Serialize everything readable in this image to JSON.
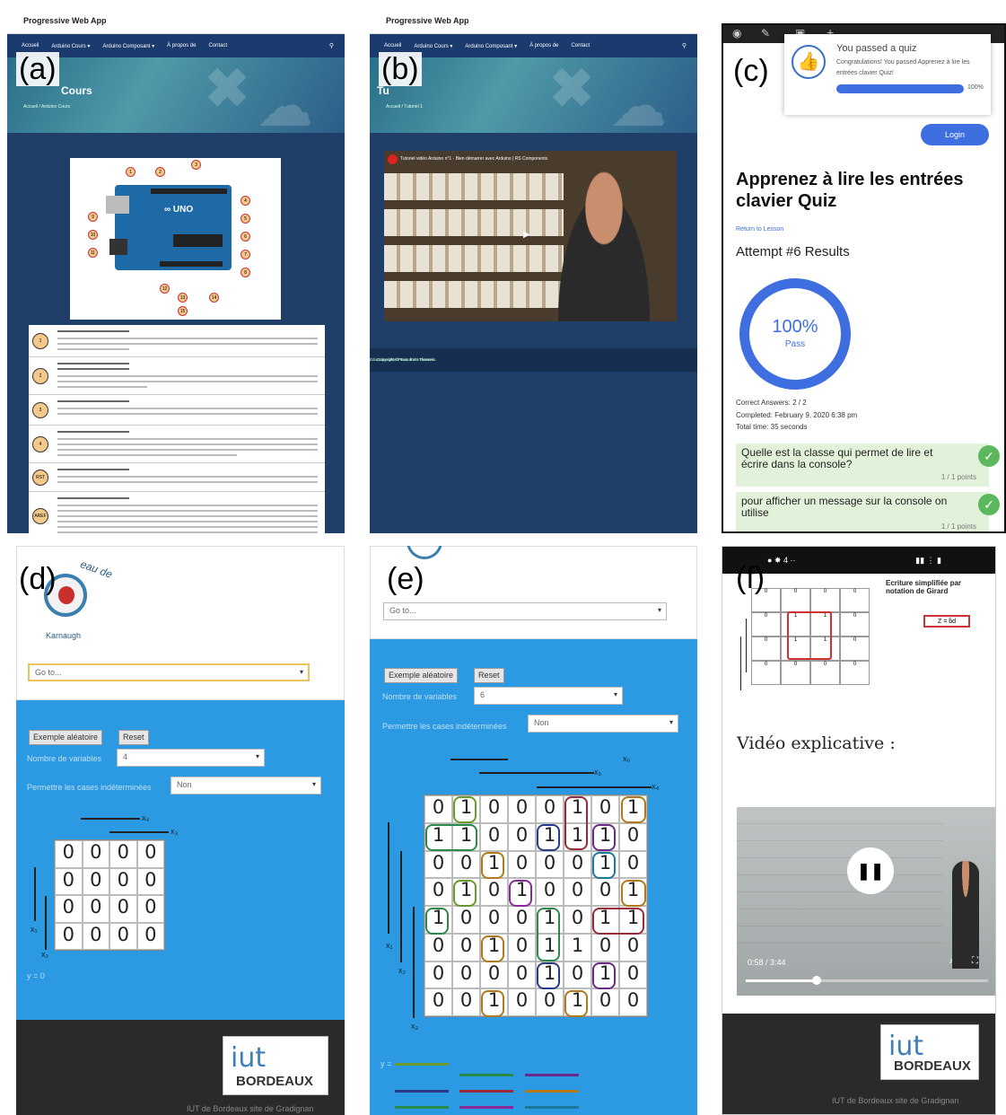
{
  "labels": {
    "a": "(a)",
    "b": "(b)",
    "c": "(c)",
    "d": "(d)",
    "e": "(e)",
    "f": "(f)"
  },
  "pwa": {
    "app_title": "Progressive Web App",
    "nav": [
      "Accueil",
      "Arduino Cours ▾",
      "Arduino Composant ▾",
      "À propos de",
      "Contact"
    ],
    "search_icon": "search-icon"
  },
  "panel_a": {
    "hero_title": "Cours",
    "crumb": "Accueil  /  Arduino Cours",
    "rows": [
      "1",
      "2",
      "3",
      "4",
      "RST",
      "AREF"
    ]
  },
  "panel_b": {
    "hero_title": "Tu",
    "crumb": "Accueil  /  Tutoriel 1",
    "video_title": "Tutoriel vidéo Arduino n°1 - Bien démarrer avec Arduino | RS Components",
    "footer_left": "Copyright © Tous droits réservés.",
    "footer_right": "Éducation WordPress Kele Themes"
  },
  "panel_c": {
    "toast_title": "You passed a quiz",
    "toast_text": "Congratulations! You passed Apprenez à lire les entrées clavier Quiz!",
    "progress": 100,
    "progress_label": "100%",
    "login": "Login",
    "heading": "Apprenez à lire les entrées clavier Quiz",
    "return_link": "Return to Lesson",
    "attempt": "Attempt #6 Results",
    "score": "100%",
    "pass": "Pass",
    "correct": "Correct Answers: 2 / 2",
    "completed": "Completed: February 9, 2020 6:38 pm",
    "total_time": "Total time: 35 seconds",
    "questions": [
      {
        "text": "Quelle est la classe qui permet de lire et écrire dans la console?",
        "points": "1 / 1 points"
      },
      {
        "text": "pour afficher un message sur la console on utilise",
        "points": "1 / 1 points"
      }
    ]
  },
  "panel_d": {
    "logo_text": "Karnaugh",
    "logo_arc": "eau de",
    "goto": "Go to...",
    "random": "Exemple aléatoire",
    "reset": "Reset",
    "nvars_label": "Nombre de variables",
    "nvars": "4",
    "indet_label": "Permettre les cases indéterminées",
    "indet": "Non",
    "cells": [
      "0",
      "0",
      "0",
      "0",
      "0",
      "0",
      "0",
      "0",
      "0",
      "0",
      "0",
      "0",
      "0",
      "0",
      "0",
      "0"
    ],
    "x1": "x₁",
    "x2": "x₂",
    "x3": "x₃",
    "x4": "x₄",
    "result": "y = 0",
    "footer": "IUT de Bordeaux site de Gradignan"
  },
  "panel_e": {
    "goto": "Go to...",
    "random": "Exemple aléatoire",
    "reset": "Reset",
    "nvars_label": "Nombre de variables",
    "nvars": "6",
    "indet_label": "Permettre les cases indéterminées",
    "indet": "Non",
    "cells": [
      "0",
      "1",
      "0",
      "0",
      "0",
      "1",
      "0",
      "1",
      "1",
      "1",
      "0",
      "0",
      "1",
      "1",
      "1",
      "0",
      "0",
      "0",
      "1",
      "0",
      "0",
      "0",
      "1",
      "0",
      "0",
      "1",
      "0",
      "1",
      "0",
      "0",
      "0",
      "1",
      "1",
      "0",
      "0",
      "0",
      "1",
      "0",
      "1",
      "1",
      "0",
      "0",
      "1",
      "0",
      "1",
      "1",
      "0",
      "0",
      "0",
      "0",
      "0",
      "0",
      "1",
      "0",
      "1",
      "0",
      "0",
      "0",
      "1",
      "0",
      "0",
      "1",
      "0",
      "0"
    ],
    "x1": "x₁",
    "x2": "x₂",
    "x3": "x₃",
    "x4": "x₄",
    "x5": "x₅",
    "x6": "x₆",
    "result_prefix": "y ="
  },
  "panel_f": {
    "side_title": "Ecriture simplifiée par notation de Girard",
    "formula": "Z = b̄d",
    "fcells": [
      "0",
      "0",
      "0",
      "0",
      "0",
      "1",
      "1",
      "0",
      "0",
      "1",
      "1",
      "0",
      "0",
      "0",
      "0",
      "0"
    ],
    "video_label": "Vidéo explicative :",
    "time": "0:58 / 3:44",
    "iut_i": "iut",
    "iut_b": "BORDEAUX",
    "footer": "IUT de Bordeaux site de Gradignan"
  },
  "iut": {
    "i": "iut",
    "b": "BORDEAUX"
  },
  "colors": {
    "nav": "#1b3a6e",
    "quiz_blue": "#3e6ee0",
    "k_blue": "#2b9ae2",
    "pass_green": "#5cb85c"
  }
}
